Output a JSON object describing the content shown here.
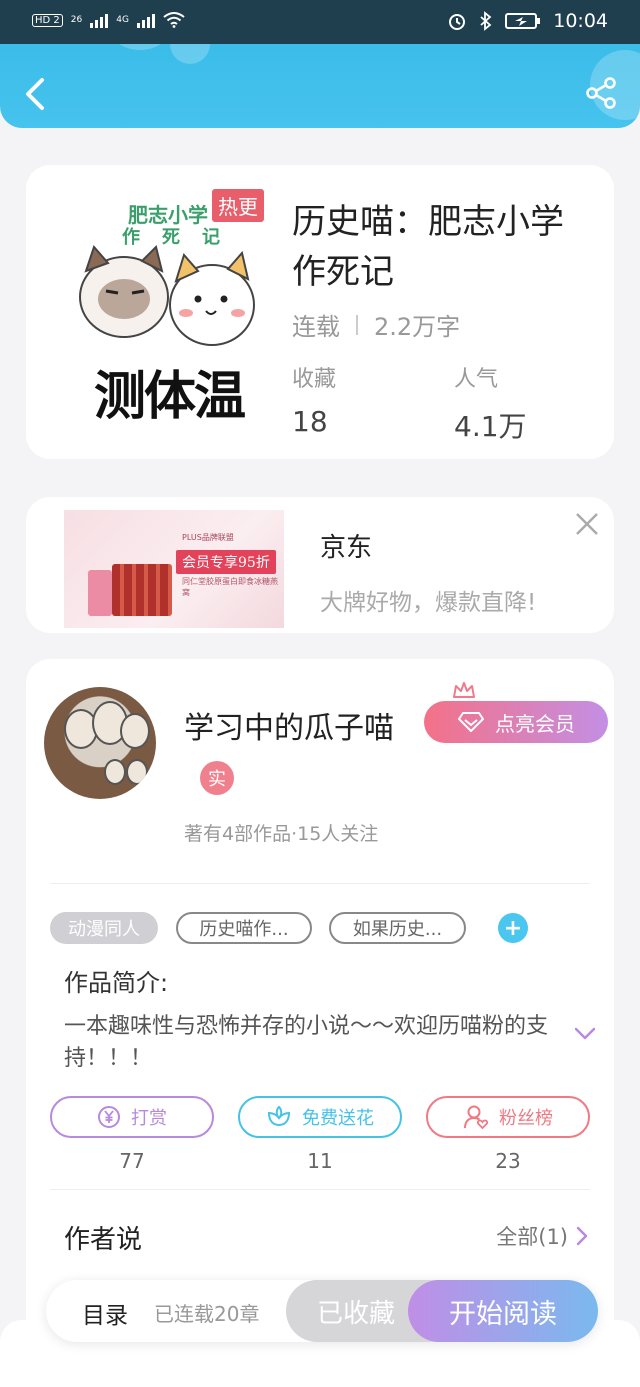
{
  "status_bar": {
    "left_items": [
      "HD 2",
      "26",
      "4G"
    ],
    "time": "10:04"
  },
  "header": {
    "back_icon": "chevron-left-icon",
    "share_icon": "share-icon"
  },
  "book": {
    "cover": {
      "hot_tag": "热更",
      "title_line1": "肥志小学",
      "title_line2": "作死记",
      "caption": "测体温"
    },
    "title": "历史喵：肥志小学作死记",
    "status": "连载",
    "word_count": "2.2万字",
    "favorites_label": "收藏",
    "favorites_value": "18",
    "popularity_label": "人气",
    "popularity_value": "4.1万"
  },
  "ad": {
    "image_badge": "PLUS品牌联盟",
    "image_headline": "会员专享95折",
    "image_subtext": "同仁堂胶原蛋白即食冰糖燕窝",
    "brand": "京东",
    "description": "大牌好物，爆款直降!"
  },
  "author": {
    "name": "学习中的瓜子喵",
    "vip_button": "点亮会员",
    "real_badge": "实",
    "stats": "著有4部作品·15人关注",
    "tags": [
      "动漫同人",
      "历史喵作...",
      "如果历史..."
    ],
    "add_tag_label": "+",
    "intro_title": "作品简介:",
    "intro_text": "一本趣味性与恐怖并存的小说～～欢迎历喵粉的支持！！！",
    "actions": [
      {
        "label": "打赏",
        "count": "77",
        "icon": "yen-coin-icon",
        "color": "#b889dc"
      },
      {
        "label": "免费送花",
        "count": "11",
        "icon": "flower-icon",
        "color": "#45c2e8"
      },
      {
        "label": "粉丝榜",
        "count": "23",
        "icon": "fan-rank-icon",
        "color": "#ef7a84"
      }
    ],
    "author_says_title": "作者说",
    "author_says_all": "全部(1)"
  },
  "bottom_bar": {
    "toc_label": "目录",
    "chapters_text": "已连载20章",
    "favorited_label": "已收藏",
    "read_label": "开始阅读"
  },
  "colors": {
    "header": "#3dbde9",
    "accent_pink": "#f47187",
    "accent_purple": "#c38fe4",
    "accent_blue": "#4ac6ef"
  }
}
